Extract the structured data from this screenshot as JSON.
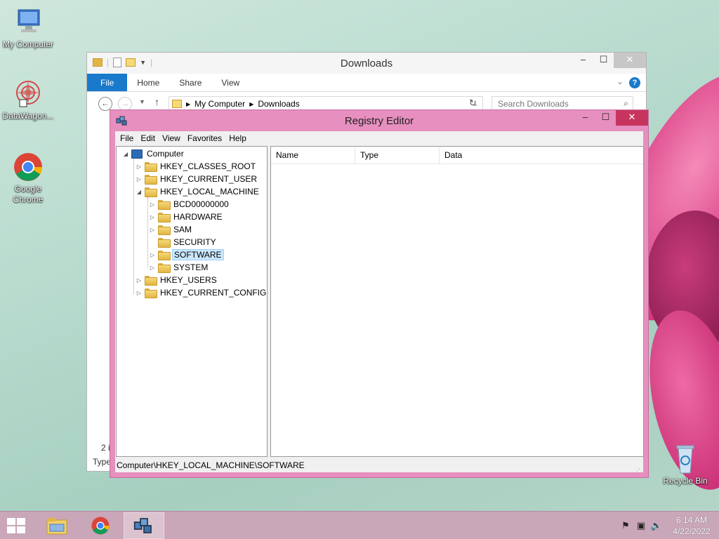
{
  "desktop": {
    "icons": [
      {
        "label": "My Computer"
      },
      {
        "label": "DataWagon..."
      },
      {
        "label": "Google Chrome"
      },
      {
        "label": "Recycle Bin"
      }
    ]
  },
  "explorer": {
    "title": "Downloads",
    "ribbon_tabs": [
      "File",
      "Home",
      "Share",
      "View"
    ],
    "help": "?",
    "address_path": [
      "My Computer",
      "Downloads"
    ],
    "search_placeholder": "Search Downloads",
    "item_count_partial": "2 i",
    "details_partial": "Type"
  },
  "registry": {
    "title": "Registry Editor",
    "menu": [
      "File",
      "Edit",
      "View",
      "Favorites",
      "Help"
    ],
    "tree": {
      "root": "Computer",
      "hives": [
        {
          "label": "HKEY_CLASSES_ROOT",
          "expander": "▷"
        },
        {
          "label": "HKEY_CURRENT_USER",
          "expander": "▷"
        },
        {
          "label": "HKEY_LOCAL_MACHINE",
          "expander": "◢"
        },
        {
          "label": "HKEY_USERS",
          "expander": "▷"
        },
        {
          "label": "HKEY_CURRENT_CONFIG",
          "expander": "▷"
        }
      ],
      "hklm_children": [
        {
          "label": "BCD00000000",
          "expander": "▷"
        },
        {
          "label": "HARDWARE",
          "expander": "▷"
        },
        {
          "label": "SAM",
          "expander": "▷"
        },
        {
          "label": "SECURITY",
          "expander": ""
        },
        {
          "label": "SOFTWARE",
          "expander": "▷",
          "selected": true
        },
        {
          "label": "SYSTEM",
          "expander": "▷"
        }
      ]
    },
    "list_columns": [
      "Name",
      "Type",
      "Data"
    ],
    "status_path": "Computer\\HKEY_LOCAL_MACHINE\\SOFTWARE"
  },
  "taskbar": {
    "time": "6:14 AM",
    "date": "4/22/2022"
  },
  "colors": {
    "accent_blue": "#1979ca",
    "registry_frame": "#e78fbf",
    "close_red": "#c7355f",
    "taskbar": "#c9a6b8"
  }
}
